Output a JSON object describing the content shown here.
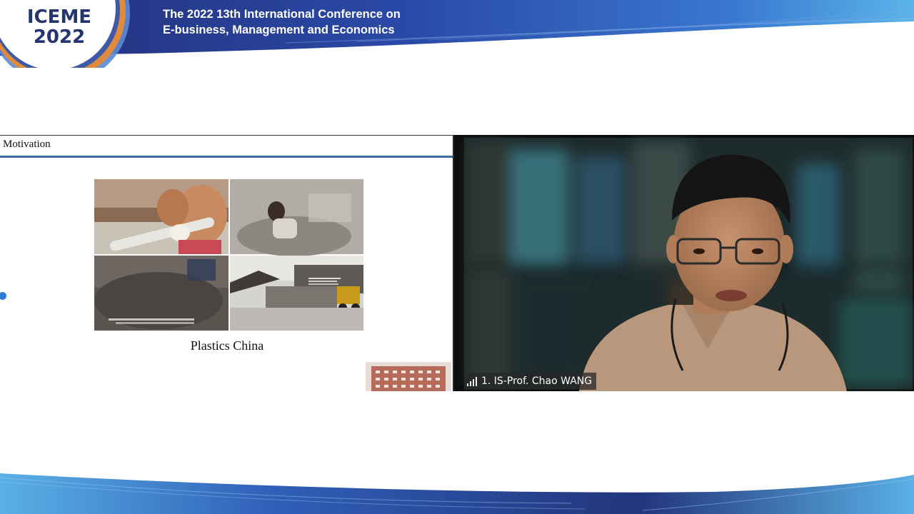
{
  "header": {
    "logo_line1": "ICEME",
    "logo_line2": "2022",
    "title_line1": "The 2022 13th International Conference on",
    "title_line2": "E-business, Management and Economics"
  },
  "slide": {
    "title": "Motivation",
    "caption": "Plastics China"
  },
  "video": {
    "participant_label": "1. IS-Prof. Chao WANG"
  },
  "colors": {
    "banner_navy": "#232f78",
    "banner_blue": "#2e57b8",
    "logo_orange": "#e08a3c",
    "logo_text": "#24356f",
    "slide_rule": "#3d6aa0"
  },
  "icons": {
    "signal": "signal-strength-icon",
    "marker": "share-marker-icon"
  }
}
